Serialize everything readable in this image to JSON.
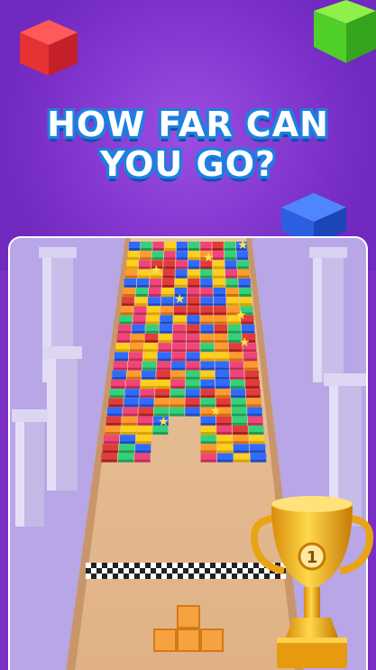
{
  "headline": {
    "line1": "HOW FAR CAN",
    "line2": "YOU GO?"
  },
  "trophy": {
    "rank_label": "1"
  },
  "colors": {
    "background": "#7a2fc4",
    "headline_outline": "#1d7fe0",
    "track": "#e2b88e",
    "player_piece": "#f39a3c"
  },
  "decor": {
    "cubes": [
      "red-cube",
      "green-cube",
      "blue-cube"
    ],
    "icons": [
      "star-icon",
      "trophy-icon"
    ]
  }
}
